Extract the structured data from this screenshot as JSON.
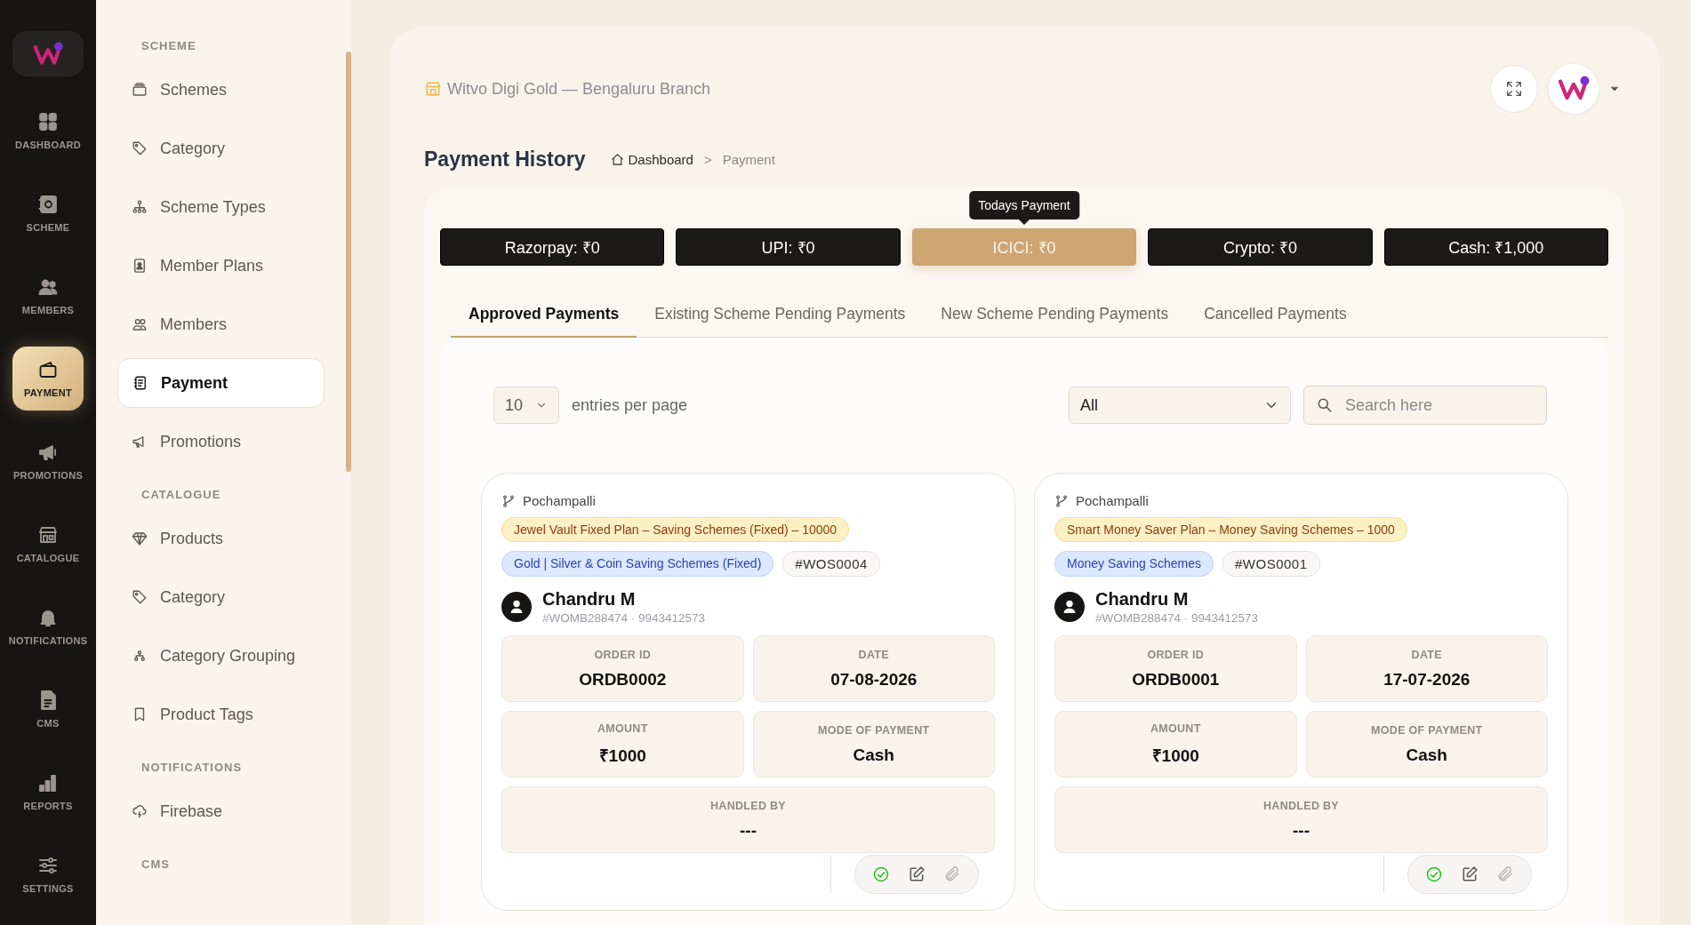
{
  "rail": {
    "items": [
      {
        "label": "DASHBOARD",
        "selected": false
      },
      {
        "label": "SCHEME",
        "selected": false
      },
      {
        "label": "MEMBERS",
        "selected": false
      },
      {
        "label": "PAYMENT",
        "selected": true
      },
      {
        "label": "PROMOTIONS",
        "selected": false
      },
      {
        "label": "CATALOGUE",
        "selected": false
      },
      {
        "label": "NOTIFICATIONS",
        "selected": false
      },
      {
        "label": "CMS",
        "selected": false
      },
      {
        "label": "REPORTS",
        "selected": false
      },
      {
        "label": "SETTINGS",
        "selected": false
      }
    ]
  },
  "sidebar": {
    "sections": [
      {
        "heading": "SCHEME",
        "items": [
          {
            "label": "Schemes",
            "selected": false
          },
          {
            "label": "Category",
            "selected": false
          },
          {
            "label": "Scheme Types",
            "selected": false
          },
          {
            "label": "Member Plans",
            "selected": false
          },
          {
            "label": "Members",
            "selected": false
          },
          {
            "label": "Payment",
            "selected": true
          },
          {
            "label": "Promotions",
            "selected": false
          }
        ]
      },
      {
        "heading": "CATALOGUE",
        "items": [
          {
            "label": "Products",
            "selected": false
          },
          {
            "label": "Category",
            "selected": false
          },
          {
            "label": "Category Grouping",
            "selected": false
          },
          {
            "label": "Product Tags",
            "selected": false
          }
        ]
      },
      {
        "heading": "NOTIFICATIONS",
        "items": [
          {
            "label": "Firebase",
            "selected": false
          }
        ]
      },
      {
        "heading": "CMS"
      }
    ]
  },
  "header": {
    "branch": "Witvo Digi Gold — Bengaluru Branch"
  },
  "page": {
    "title": "Payment History",
    "breadcrumb": [
      "Dashboard",
      "Payment"
    ],
    "separator": ">"
  },
  "summary": [
    {
      "label": "Razorpay: ₹0",
      "selected": false
    },
    {
      "label": "UPI: ₹0",
      "selected": false
    },
    {
      "label": "ICICI: ₹0",
      "selected": true,
      "tooltip": "Todays Payment"
    },
    {
      "label": "Crypto: ₹0",
      "selected": false
    },
    {
      "label": "Cash: ₹1,000",
      "selected": false
    }
  ],
  "tabs": [
    {
      "label": "Approved Payments",
      "selected": true
    },
    {
      "label": "Existing Scheme Pending Payments",
      "selected": false
    },
    {
      "label": "New Scheme Pending Payments",
      "selected": false
    },
    {
      "label": "Cancelled Payments",
      "selected": false
    }
  ],
  "controls": {
    "page_size": "10",
    "page_size_label": "entries per page",
    "filter": "All",
    "search": {
      "placeholder": "Search here"
    }
  },
  "cards": [
    {
      "branch": "Pochampalli",
      "plan": "Jewel Vault Fixed Plan – Saving Schemes (Fixed) – 10000",
      "category": "Gold | Silver & Coin Saving Schemes (Fixed)",
      "code": "#WOS0004",
      "name": "Chandru M",
      "meta": "#WOMB288474 · 9943412573",
      "fields": [
        {
          "label": "ORDER ID",
          "value": "ORDB0002"
        },
        {
          "label": "DATE",
          "value": "07-08-2026"
        },
        {
          "label": "AMOUNT",
          "value": "₹1000"
        },
        {
          "label": "MODE OF PAYMENT",
          "value": "Cash"
        },
        {
          "label": "HANDLED BY",
          "value": "---"
        }
      ]
    },
    {
      "branch": "Pochampalli",
      "plan": "Smart Money Saver Plan – Money Saving Schemes – 1000",
      "category": "Money Saving Schemes",
      "code": "#WOS0001",
      "name": "Chandru M",
      "meta": "#WOMB288474 · 9943412573",
      "fields": [
        {
          "label": "ORDER ID",
          "value": "ORDB0001"
        },
        {
          "label": "DATE",
          "value": "17-07-2026"
        },
        {
          "label": "AMOUNT",
          "value": "₹1000"
        },
        {
          "label": "MODE OF PAYMENT",
          "value": "Cash"
        },
        {
          "label": "HANDLED BY",
          "value": "---"
        }
      ]
    }
  ]
}
